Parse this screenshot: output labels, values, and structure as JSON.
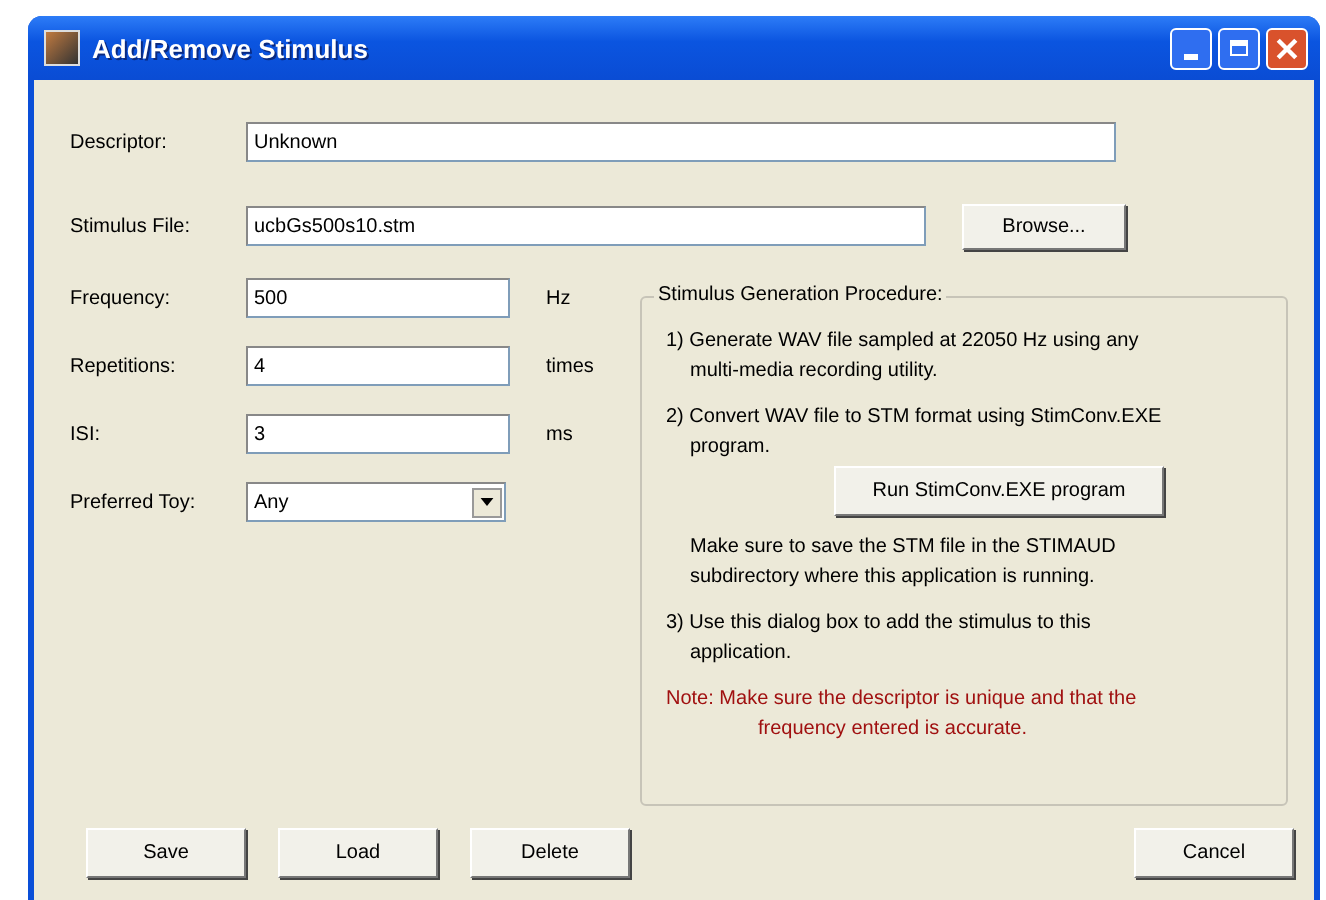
{
  "window": {
    "title": "Add/Remove Stimulus"
  },
  "descriptor": {
    "label": "Descriptor:",
    "value": "Unknown"
  },
  "stimulus_file": {
    "label": "Stimulus File:",
    "value": "ucbGs500s10.stm",
    "button": "Browse..."
  },
  "fields": [
    {
      "kind": "text",
      "label": "Frequency:",
      "value": "500",
      "unit": "Hz"
    },
    {
      "kind": "text",
      "label": "Repetitions:",
      "value": "4",
      "unit": "times"
    },
    {
      "kind": "text",
      "label": "ISI:",
      "value": "3",
      "unit": "ms"
    },
    {
      "kind": "select",
      "label": "Preferred Toy:",
      "value": "Any"
    }
  ],
  "procedure": {
    "title": "Stimulus Generation Procedure:",
    "items": [
      {
        "kind": "step",
        "text": "1) Generate WAV file sampled at 22050 Hz using any multi-media recording utility."
      },
      {
        "kind": "step",
        "text": "2) Convert WAV file to STM  format using StimConv.EXE program."
      },
      {
        "kind": "button",
        "text": "Run StimConv.EXE program"
      },
      {
        "kind": "hint",
        "text": "Make sure to save the STM file in the STIMAUD subdirectory where this application is running."
      },
      {
        "kind": "step",
        "text": "3) Use this dialog box to add the stimulus to this application."
      },
      {
        "kind": "note",
        "text": "Note: Make sure the descriptor is unique and that the frequency entered is accurate."
      }
    ]
  },
  "buttons": [
    {
      "label": "Save",
      "kind": "action"
    },
    {
      "label": "Load",
      "kind": "action"
    },
    {
      "label": "Delete",
      "kind": "action"
    },
    {
      "label": "Cancel",
      "kind": "cancel"
    }
  ]
}
